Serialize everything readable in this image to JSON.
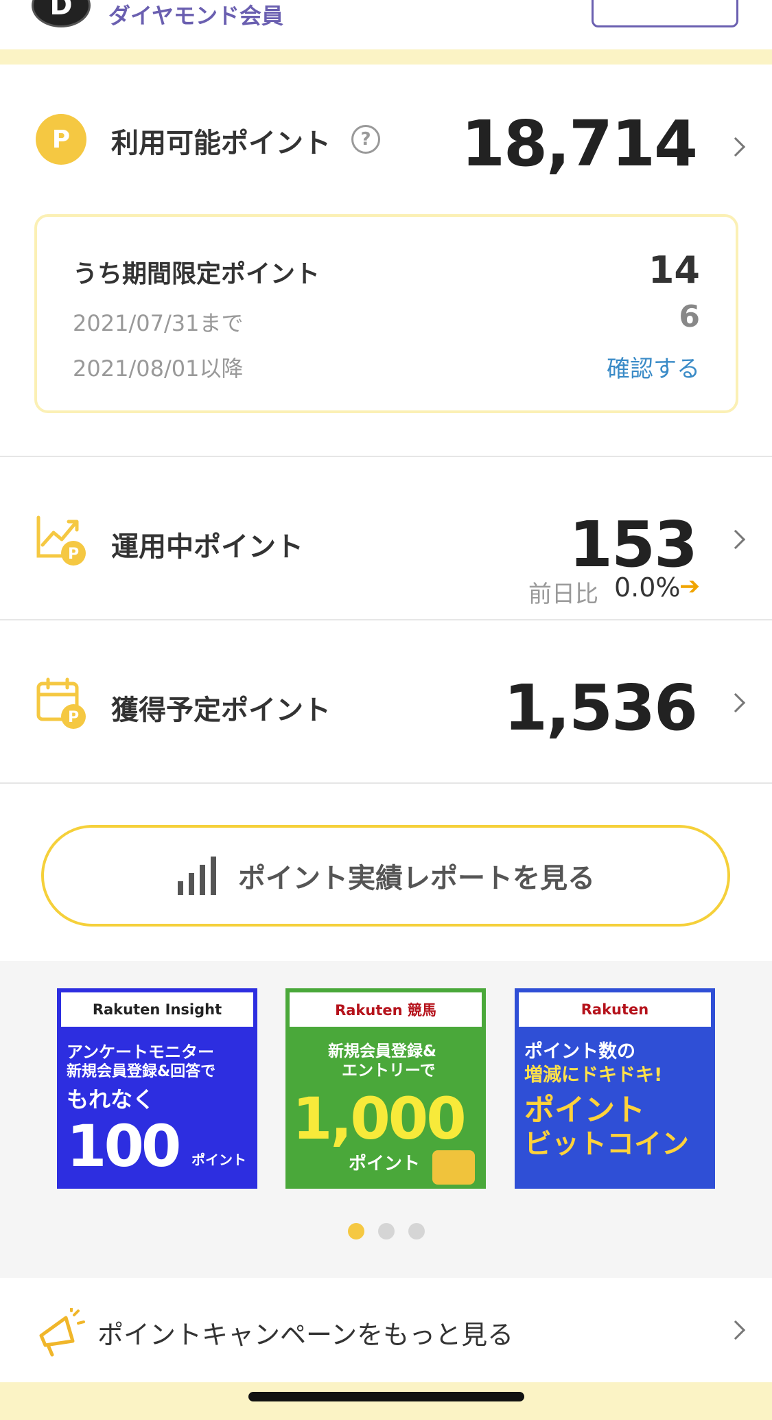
{
  "header": {
    "rank_badge": "D",
    "rank_label": "ダイヤモンド会員"
  },
  "available": {
    "coin_letter": "P",
    "label": "利用可能ポイント",
    "help_symbol": "?",
    "value": "18,714",
    "limited": {
      "title": "うち期間限定ポイント",
      "total": "14",
      "row1_label": "2021/07/31まで",
      "row1_value": "6",
      "row2_label": "2021/08/01以降",
      "row2_link": "確認する"
    }
  },
  "invest": {
    "label": "運用中ポイント",
    "value": "153",
    "diff_label": "前日比",
    "diff_value": "0.0%",
    "diff_arrow": "➔"
  },
  "upcoming": {
    "label": "獲得予定ポイント",
    "value": "1,536"
  },
  "report_button": "ポイント実績レポートを見る",
  "banners": [
    {
      "brand": "Rakuten Insight",
      "line1": "アンケートモニター",
      "line2": "新規会員登録&回答で",
      "line3": "もれなく",
      "big": "100",
      "unit": "ポイント",
      "bg": "#2d2ee0"
    },
    {
      "brand": "Rakuten 競馬",
      "line1": "新規会員登録&",
      "line2": "エントリーで",
      "big": "1,000",
      "unit": "ポイント",
      "bg": "#4aa83a"
    },
    {
      "brand": "Rakuten",
      "line1": "ポイント数の",
      "line2": "増減にドキドキ!",
      "line3": "ポイント",
      "line4": "ビットコイン",
      "bg": "#2f4fd6"
    }
  ],
  "carousel": {
    "active_index": 0,
    "count": 3
  },
  "campaign": {
    "label": "ポイントキャンペーンをもっと見る"
  },
  "colors": {
    "accent_yellow": "#f5c842",
    "link_blue": "#3a8bc7",
    "rank_purple": "#6a5fb0"
  }
}
